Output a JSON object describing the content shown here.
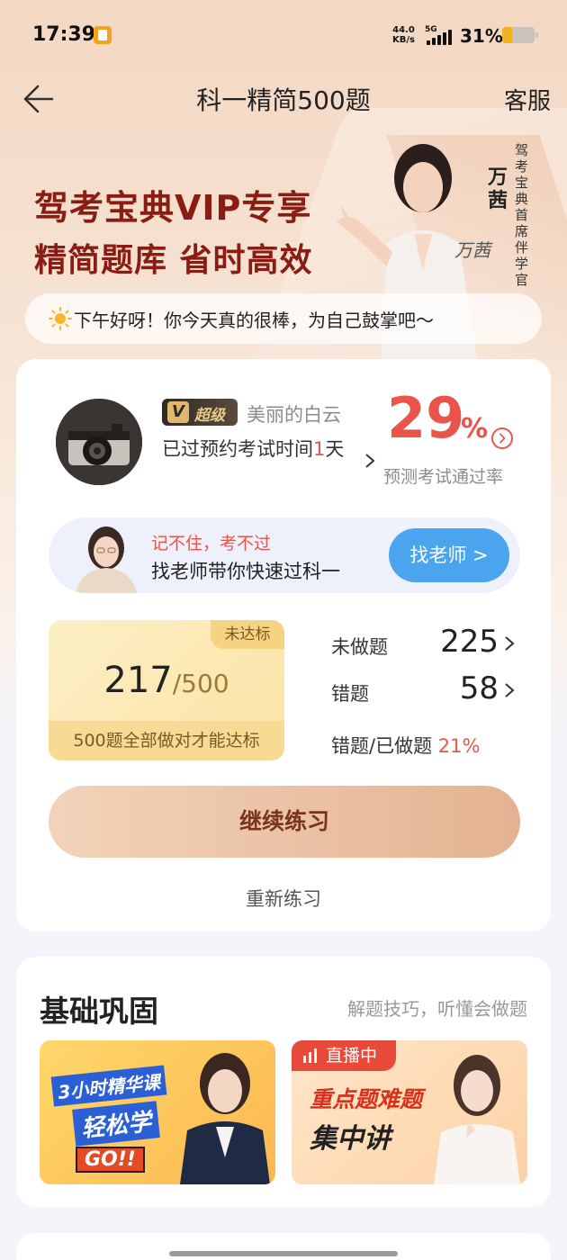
{
  "status_bar": {
    "time": "17:39",
    "net_speed_value": "44.0",
    "net_speed_unit": "KB/s",
    "network_type": "5G",
    "battery": "31%"
  },
  "nav": {
    "title": "科一精简500题",
    "service": "客服"
  },
  "banner": {
    "line1": "驾考宝典VIP专享",
    "line2": "精简题库 省时高效",
    "presenter_name": "万茜",
    "presenter_title": "驾考宝典首席伴学官",
    "signature": "万茜",
    "greeting": "下午好呀！你今天真的很棒，为自己鼓掌吧～"
  },
  "profile": {
    "vip_label": "超级",
    "username": "美丽的白云",
    "exam_text_prefix": "已过预约考试时间",
    "exam_days": "1",
    "exam_text_suffix": "天",
    "pass_rate": "29",
    "pass_rate_unit": "%",
    "pass_rate_label": "预测考试通过率"
  },
  "teacher": {
    "subtitle": "记不住，考不过",
    "main": "找老师带你快速过科一",
    "button": "找老师 >"
  },
  "progress": {
    "tag": "未达标",
    "done": "217",
    "total": "/500",
    "note": "500题全部做对才能达标"
  },
  "stats": {
    "undone_label": "未做题",
    "undone_value": "225",
    "wrong_label": "错题",
    "wrong_value": "58",
    "ratio_label": "错题/已做题",
    "ratio_value": "21%"
  },
  "actions": {
    "continue": "继续练习",
    "restart": "重新练习"
  },
  "basic": {
    "title": "基础巩固",
    "subtitle": "解题技巧，听懂会做题",
    "course1_line1": "3小时精华课",
    "course1_line2": "轻松学",
    "course1_go": "GO!!",
    "course2_live": "直播中",
    "course2_line1": "重点题难题",
    "course2_line2": "集中讲"
  },
  "colors": {
    "accent_red": "#e9544b",
    "brand_dark_red": "#8a1d13",
    "teacher_button": "#4aa5ee"
  }
}
